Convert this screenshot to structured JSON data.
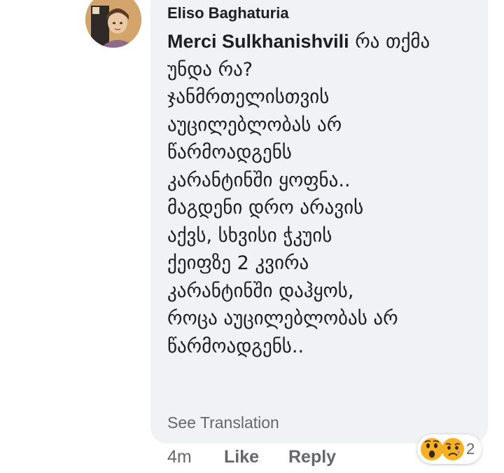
{
  "comment": {
    "author": "Eliso Baghaturia",
    "mention": "Merci Sulkhanishvili",
    "lines": [
      "რა თქმა",
      "უნდა რა?",
      "ჯანმრთელისთვის",
      "აუცილებლობას არ",
      "წარმოადგენს",
      "კარანტინში ყოფნა..",
      "მაგდენი დრო არავის",
      "აქვს, სხვისი ჭკუის",
      "ქეიფზე 2 კვირა",
      "კარანტინში დაჰყოს,",
      "როცა აუცილებლობას არ",
      "წარმოადგენს.."
    ],
    "see_translation": "See Translation",
    "time": "4m",
    "like_label": "Like",
    "reply_label": "Reply",
    "reactions": {
      "icons": [
        "wow-reaction-icon",
        "sad-reaction-icon"
      ],
      "count": "2"
    }
  },
  "colors": {
    "bubble": "#f0f2f5",
    "text": "#1c1e21",
    "secondary": "#65676b",
    "reaction_yellow": "#f7b125"
  }
}
